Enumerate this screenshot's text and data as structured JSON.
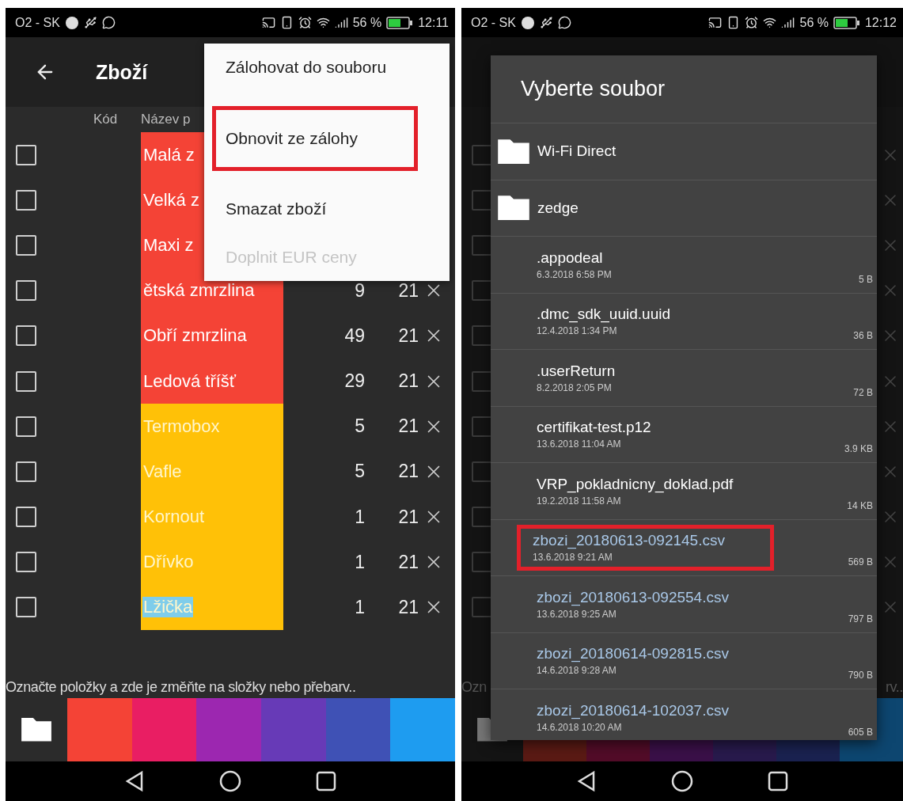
{
  "left_phone": {
    "status_bar": {
      "carrier": "O2 - SK",
      "battery": "56 %",
      "time": "12:11"
    },
    "app_bar": {
      "title": "Zboží"
    },
    "columns": [
      "Kód",
      "Název p"
    ],
    "rows": [
      {
        "name": "Malá z",
        "color": "#f44336",
        "checked": false,
        "text_highlighted": false
      },
      {
        "name": "Velká z",
        "color": "#f44336",
        "checked": false,
        "text_highlighted": false
      },
      {
        "name": "Maxi z",
        "color": "#f44336",
        "checked": false,
        "text_highlighted": false
      },
      {
        "name": "ětská zmrzlina",
        "color": "#f44336",
        "checked": false,
        "text_highlighted": false,
        "price": "9",
        "vat": "21"
      },
      {
        "name": "Obří zmrzlina",
        "color": "#f44336",
        "checked": false,
        "text_highlighted": false,
        "price": "49",
        "vat": "21"
      },
      {
        "name": "Ledová tříšť",
        "color": "#f44336",
        "checked": false,
        "text_highlighted": false,
        "price": "29",
        "vat": "21"
      },
      {
        "name": "Termobox",
        "color": "#ffc107",
        "checked": false,
        "text_highlighted": false,
        "price": "5",
        "vat": "21"
      },
      {
        "name": "Vafle",
        "color": "#ffc107",
        "checked": false,
        "text_highlighted": false,
        "price": "5",
        "vat": "21"
      },
      {
        "name": "Kornout",
        "color": "#ffc107",
        "checked": false,
        "text_highlighted": false,
        "price": "1",
        "vat": "21"
      },
      {
        "name": "Dřívko",
        "color": "#ffc107",
        "checked": false,
        "text_highlighted": false,
        "price": "1",
        "vat": "21"
      },
      {
        "name": "Lžička",
        "color": "#ffc107",
        "checked": false,
        "text_highlighted": true,
        "price": "1",
        "vat": "21"
      }
    ],
    "menu": {
      "items": [
        {
          "label": "Zálohovat do souboru",
          "disabled": false,
          "annotated": false
        },
        {
          "label": "Obnovit ze zálohy",
          "disabled": false,
          "annotated": true
        },
        {
          "label": "Smazat zboží",
          "disabled": false,
          "annotated": false
        },
        {
          "label": "Doplnit EUR ceny",
          "disabled": true,
          "annotated": false
        }
      ]
    },
    "hint": "Označte položky a zde je změňte na složky nebo přebarv..",
    "palette": [
      {
        "color": "#f44336"
      },
      {
        "color": "#e91e63"
      },
      {
        "color": "#9c27b0"
      },
      {
        "color": "#673ab7"
      },
      {
        "color": "#3f51b5"
      },
      {
        "color": "#1e9cf0"
      }
    ]
  },
  "right_phone": {
    "status_bar": {
      "carrier": "O2 - SK",
      "battery": "56 %",
      "time": "12:12"
    },
    "backdrop": {
      "rows": [
        {
          "checked": false
        },
        {
          "checked": false
        },
        {
          "checked": false
        },
        {
          "checked": false
        },
        {
          "checked": false
        },
        {
          "checked": false
        },
        {
          "checked": false
        },
        {
          "checked": false
        },
        {
          "checked": false
        },
        {
          "checked": false
        },
        {
          "checked": false
        }
      ],
      "hint_start": "Ozn",
      "hint_end": "rv..",
      "palette": [
        {
          "color": "#5a1a14"
        },
        {
          "color": "#520c28"
        },
        {
          "color": "#3a1048"
        },
        {
          "color": "#281a4c"
        },
        {
          "color": "#1a2250"
        },
        {
          "color": "#0d4670"
        }
      ]
    },
    "dialog": {
      "title": "Vyberte soubor",
      "items": [
        {
          "kind": "folder",
          "name": "Wi-Fi Direct",
          "color": "#ffffff"
        },
        {
          "kind": "folder",
          "name": "zedge",
          "color": "#ffffff"
        },
        {
          "kind": "file",
          "name": ".appodeal",
          "date": "6.3.2018 6:58 PM",
          "size": "5 B",
          "color": "#ffffff",
          "annotated": false
        },
        {
          "kind": "file",
          "name": ".dmc_sdk_uuid.uuid",
          "date": "12.4.2018 1:34 PM",
          "size": "36 B",
          "color": "#ffffff",
          "annotated": false
        },
        {
          "kind": "file",
          "name": ".userReturn",
          "date": "8.2.2018 2:05 PM",
          "size": "72 B",
          "color": "#ffffff",
          "annotated": false
        },
        {
          "kind": "file",
          "name": "certifikat-test.p12",
          "date": "13.6.2018 11:04 AM",
          "size": "3.9 KB",
          "color": "#ffffff",
          "annotated": false
        },
        {
          "kind": "file",
          "name": "VRP_pokladnicny_doklad.pdf",
          "date": "19.2.2018 11:58 AM",
          "size": "14 KB",
          "color": "#ffffff",
          "annotated": false
        },
        {
          "kind": "file",
          "name": "zbozi_20180613-092145.csv",
          "date": "13.6.2018 9:21 AM",
          "size": "569 B",
          "color": "#a9c8e8",
          "annotated": true
        },
        {
          "kind": "file",
          "name": "zbozi_20180613-092554.csv",
          "date": "13.6.2018 9:25 AM",
          "size": "797 B",
          "color": "#a9c8e8",
          "annotated": false
        },
        {
          "kind": "file",
          "name": "zbozi_20180614-092815.csv",
          "date": "14.6.2018 9:28 AM",
          "size": "790 B",
          "color": "#a9c8e8",
          "annotated": false
        },
        {
          "kind": "file",
          "name": "zbozi_20180614-102037.csv",
          "date": "14.6.2018 10:20 AM",
          "size": "605 B",
          "color": "#a9c8e8",
          "annotated": false
        }
      ]
    }
  }
}
